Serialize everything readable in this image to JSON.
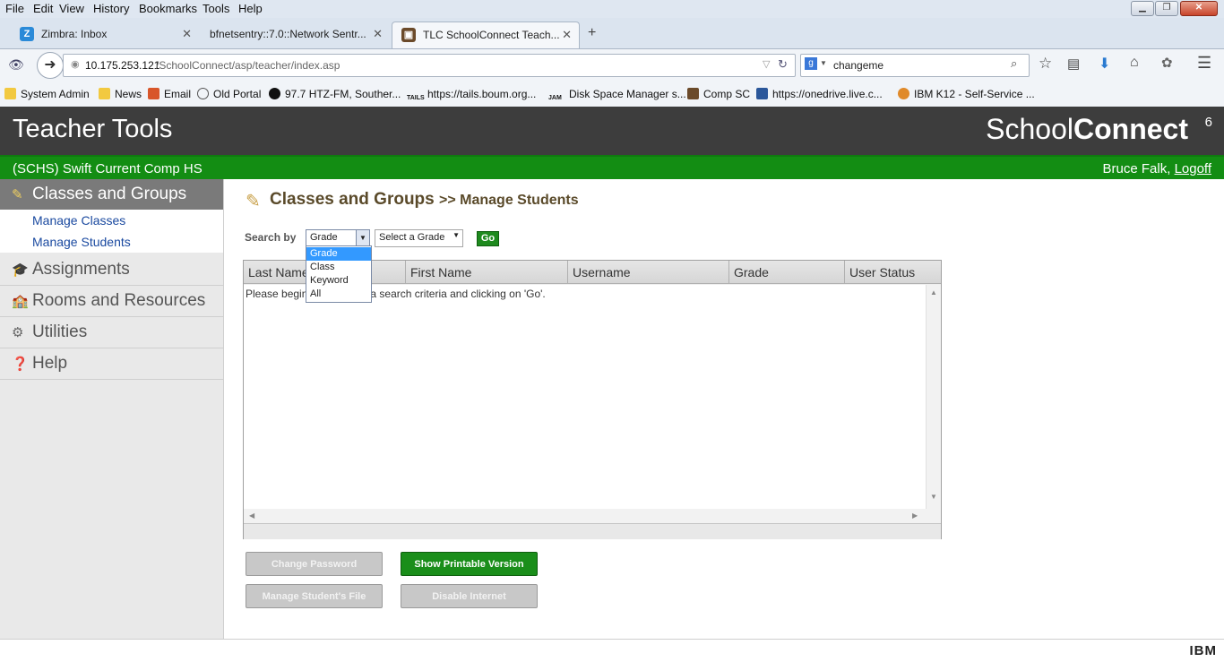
{
  "browser": {
    "menu": [
      "File",
      "Edit",
      "View",
      "History",
      "Bookmarks",
      "Tools",
      "Help"
    ],
    "tabs": [
      {
        "label": "Zimbra: Inbox",
        "icon": "Z"
      },
      {
        "label": "bfnetsentry::7.0::Network Sentr...",
        "icon": ""
      },
      {
        "label": "TLC SchoolConnect Teach...",
        "icon": ""
      }
    ],
    "url_host": "10.175.253.121",
    "url_path": "/SchoolConnect/asp/teacher/index.asp",
    "search_value": "changeme",
    "bookmarks": [
      "System Admin",
      "News",
      "Email",
      "Old Portal",
      "97.7 HTZ-FM, Souther...",
      "https://tails.boum.org...",
      "Disk Space Manager s...",
      "Comp SC",
      "https://onedrive.live.c...",
      "IBM K12 - Self-Service ..."
    ]
  },
  "app": {
    "title": "Teacher Tools",
    "brand_regular": "School",
    "brand_bold": "Connect",
    "brand_version": "6",
    "school": "(SCHS) Swift Current Comp HS",
    "user": "Bruce Falk,",
    "logoff": "Logoff"
  },
  "sidebar": {
    "sections": [
      "Classes and Groups",
      "Assignments",
      "Rooms and Resources",
      "Utilities",
      "Help"
    ],
    "sub_items": [
      "Manage Classes",
      "Manage Students"
    ]
  },
  "main": {
    "title": "Classes and Groups",
    "subtitle": ">> Manage Students",
    "search_label": "Search by",
    "search_by_value": "Grade",
    "grade_placeholder": "Select a Grade",
    "go_label": "Go",
    "dropdown_options": [
      "Grade",
      "Class",
      "Keyword",
      "All"
    ],
    "columns": [
      "Last Name",
      "First Name",
      "Username",
      "Grade",
      "User Status"
    ],
    "empty_message": "Please begin by selecting a search criteria and clicking on 'Go'.",
    "buttons": {
      "change_password": "Change Password",
      "printable": "Show Printable Version",
      "student_file": "Manage Student's File",
      "disable_internet": "Disable Internet"
    }
  },
  "footer": {
    "brand": "IBM"
  },
  "colors": {
    "header_bg": "#3d3d3d",
    "green_bar": "#138d13",
    "sidebar_active": "#7a7a7a",
    "link": "#1b4aa0"
  }
}
